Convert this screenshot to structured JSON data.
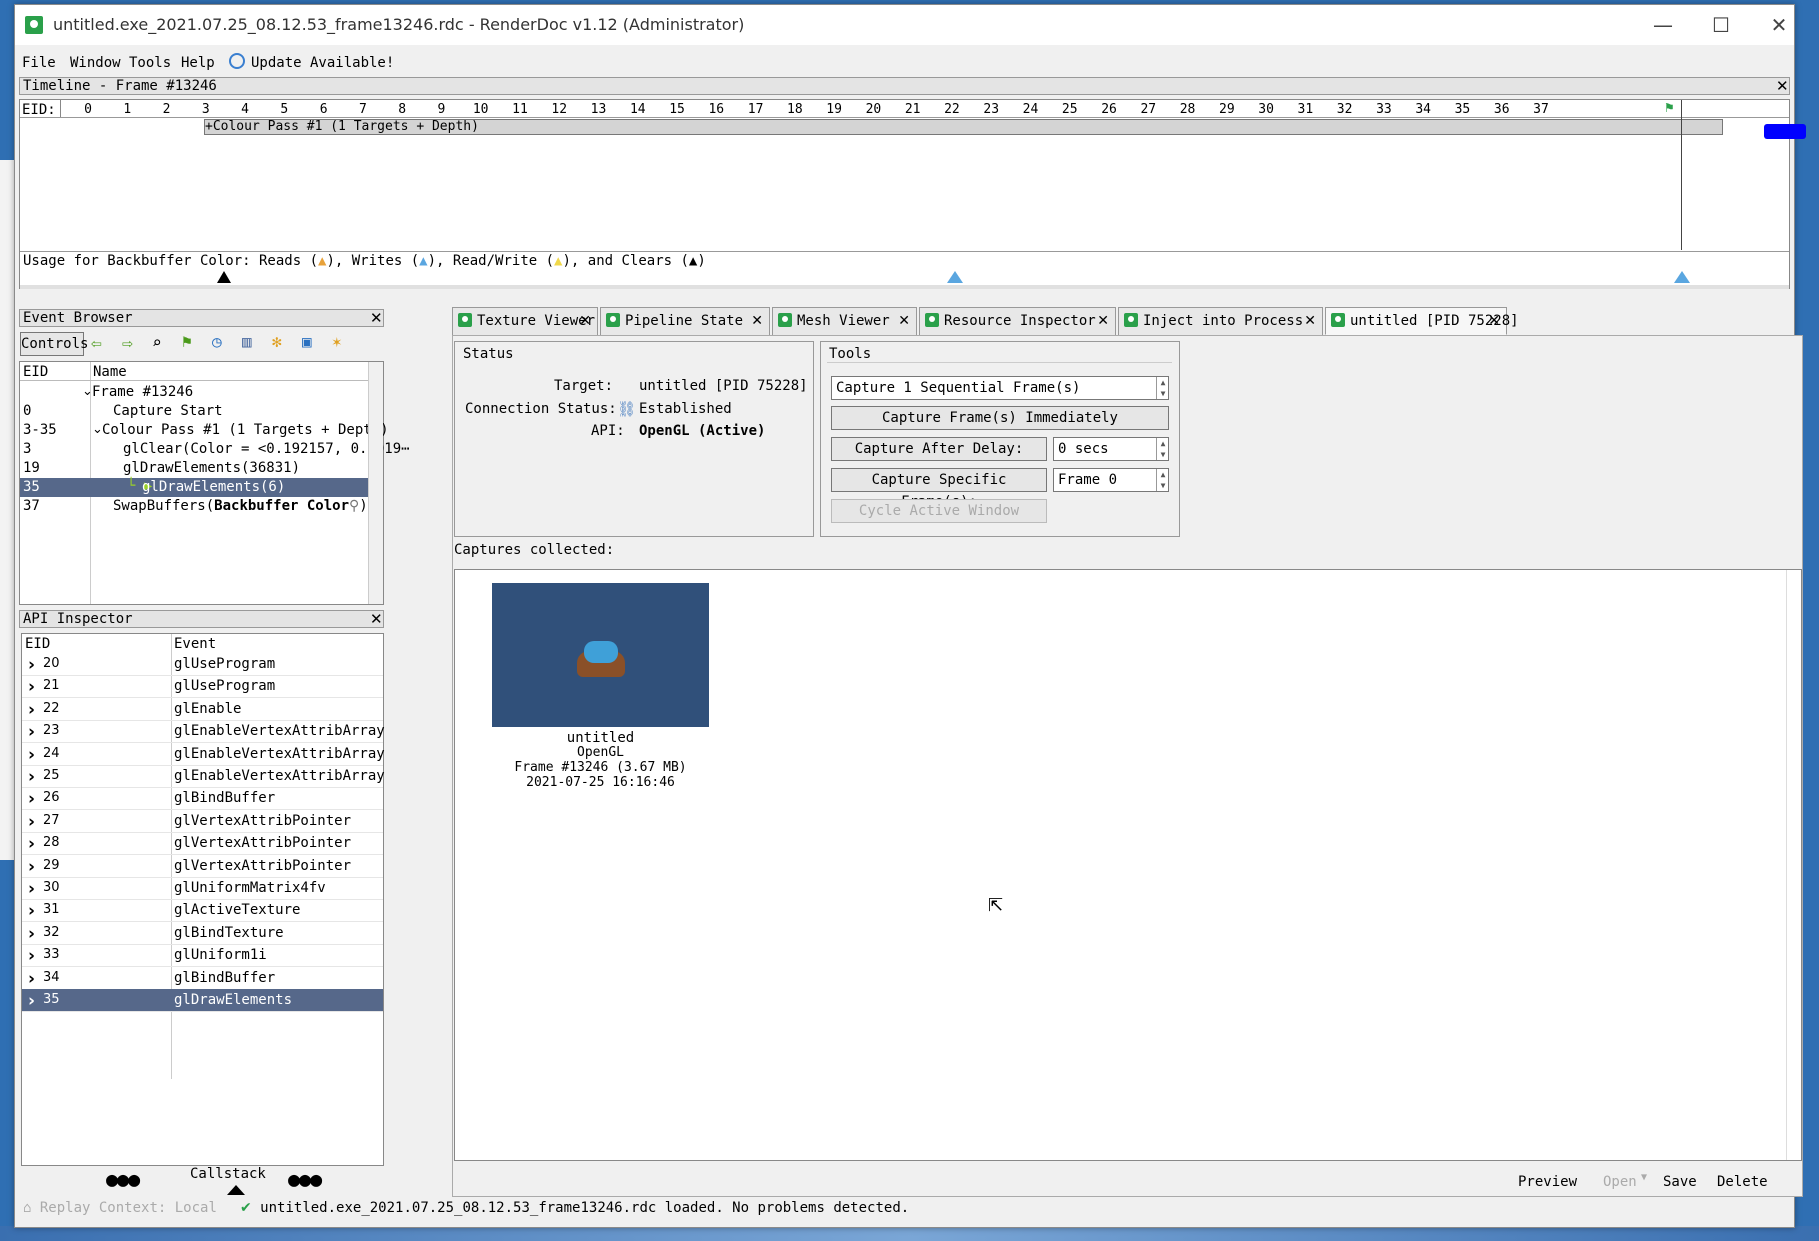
{
  "window": {
    "title": "untitled.exe_2021.07.25_08.12.53_frame13246.rdc - RenderDoc v1.12 (Administrator)",
    "minimize": "—",
    "maximize": "☐",
    "close": "✕"
  },
  "menu": {
    "file": "File",
    "window": "Window",
    "tools": "Tools",
    "help": "Help",
    "update": "Update Available!"
  },
  "timeline": {
    "title": "Timeline - Frame #13246",
    "eid_label": "EID:",
    "ticks": [
      "0",
      "1",
      "2",
      "3",
      "4",
      "5",
      "6",
      "7",
      "8",
      "9",
      "10",
      "11",
      "12",
      "13",
      "14",
      "15",
      "16",
      "17",
      "18",
      "19",
      "20",
      "21",
      "22",
      "23",
      "24",
      "25",
      "26",
      "27",
      "28",
      "29",
      "30",
      "31",
      "32",
      "33",
      "34",
      "35",
      "36",
      "37"
    ],
    "pass_label": "+Colour Pass #1 (1 Targets + Depth)",
    "usage_text_1": "Usage for Backbuffer Color: Reads (",
    "usage_text_2": "), Writes (",
    "usage_text_3": "), Read/Write (",
    "usage_text_4": "), and Clears (",
    "usage_text_5": ")",
    "colors": {
      "reads": "#e8a23a",
      "writes": "#5aa6e0",
      "readwrite": "#f0d84a",
      "clears": "#000000",
      "selection": "#0000ff"
    }
  },
  "event_browser": {
    "title": "Event Browser",
    "controls_label": "Controls",
    "col_eid": "EID",
    "col_name": "Name",
    "rows": [
      {
        "eid": "",
        "name": "Frame #13246"
      },
      {
        "eid": "0",
        "name": "Capture Start"
      },
      {
        "eid": "3-35",
        "name": "Colour Pass #1 (1 Targets + Depth)"
      },
      {
        "eid": "3",
        "name": "glClear(Color = <0.192157, 0.3019⋯"
      },
      {
        "eid": "19",
        "name": "glDrawElements(36831)"
      },
      {
        "eid": "35",
        "name": "glDrawElements(6)"
      },
      {
        "eid": "37",
        "name": "SwapBuffers(",
        "bold": "Backbuffer Color",
        "tail": ")"
      }
    ]
  },
  "api_inspector": {
    "title": "API Inspector",
    "col_eid": "EID",
    "col_event": "Event",
    "rows": [
      {
        "eid": "20",
        "event": "glUseProgram"
      },
      {
        "eid": "21",
        "event": "glUseProgram"
      },
      {
        "eid": "22",
        "event": "glEnable"
      },
      {
        "eid": "23",
        "event": "glEnableVertexAttribArray"
      },
      {
        "eid": "24",
        "event": "glEnableVertexAttribArray"
      },
      {
        "eid": "25",
        "event": "glEnableVertexAttribArray"
      },
      {
        "eid": "26",
        "event": "glBindBuffer"
      },
      {
        "eid": "27",
        "event": "glVertexAttribPointer"
      },
      {
        "eid": "28",
        "event": "glVertexAttribPointer"
      },
      {
        "eid": "29",
        "event": "glVertexAttribPointer"
      },
      {
        "eid": "30",
        "event": "glUniformMatrix4fv"
      },
      {
        "eid": "31",
        "event": "glActiveTexture"
      },
      {
        "eid": "32",
        "event": "glBindTexture"
      },
      {
        "eid": "33",
        "event": "glUniform1i"
      },
      {
        "eid": "34",
        "event": "glBindBuffer"
      },
      {
        "eid": "35",
        "event": "glDrawElements"
      }
    ],
    "callstack_label": "Callstack"
  },
  "tabs": [
    "Texture Viewer",
    "Pipeline State",
    "Mesh Viewer",
    "Resource Inspector",
    "Inject into Process",
    "untitled [PID 75228]"
  ],
  "status": {
    "title": "Status",
    "target_label": "Target:",
    "target_value": "untitled [PID 75228]",
    "conn_label": "Connection Status:",
    "conn_value": "Established",
    "api_label": "API:",
    "api_value": "OpenGL (Active)"
  },
  "tools": {
    "title": "Tools",
    "capture_frames": "Capture 1 Sequential Frame(s)",
    "capture_immediately": "Capture Frame(s) Immediately",
    "capture_after_delay": "Capture After Delay:",
    "delay_value": "0 secs",
    "capture_specific": "Capture Specific Frame(s):",
    "frame_value": "Frame 0",
    "cycle_window": "Cycle Active Window"
  },
  "captures": {
    "label": "Captures collected:",
    "item": {
      "name": "untitled",
      "api": "OpenGL",
      "frame": "Frame #13246 (3.67 MB)",
      "date": "2021-07-25 16:16:46"
    },
    "thumb_bg": "#30507a"
  },
  "bottom_buttons": {
    "preview": "Preview",
    "open": "Open",
    "save": "Save",
    "delete": "Delete"
  },
  "statusbar": {
    "replay": "Replay Context: Local",
    "message": "untitled.exe_2021.07.25_08.12.53_frame13246.rdc loaded. No problems detected."
  }
}
